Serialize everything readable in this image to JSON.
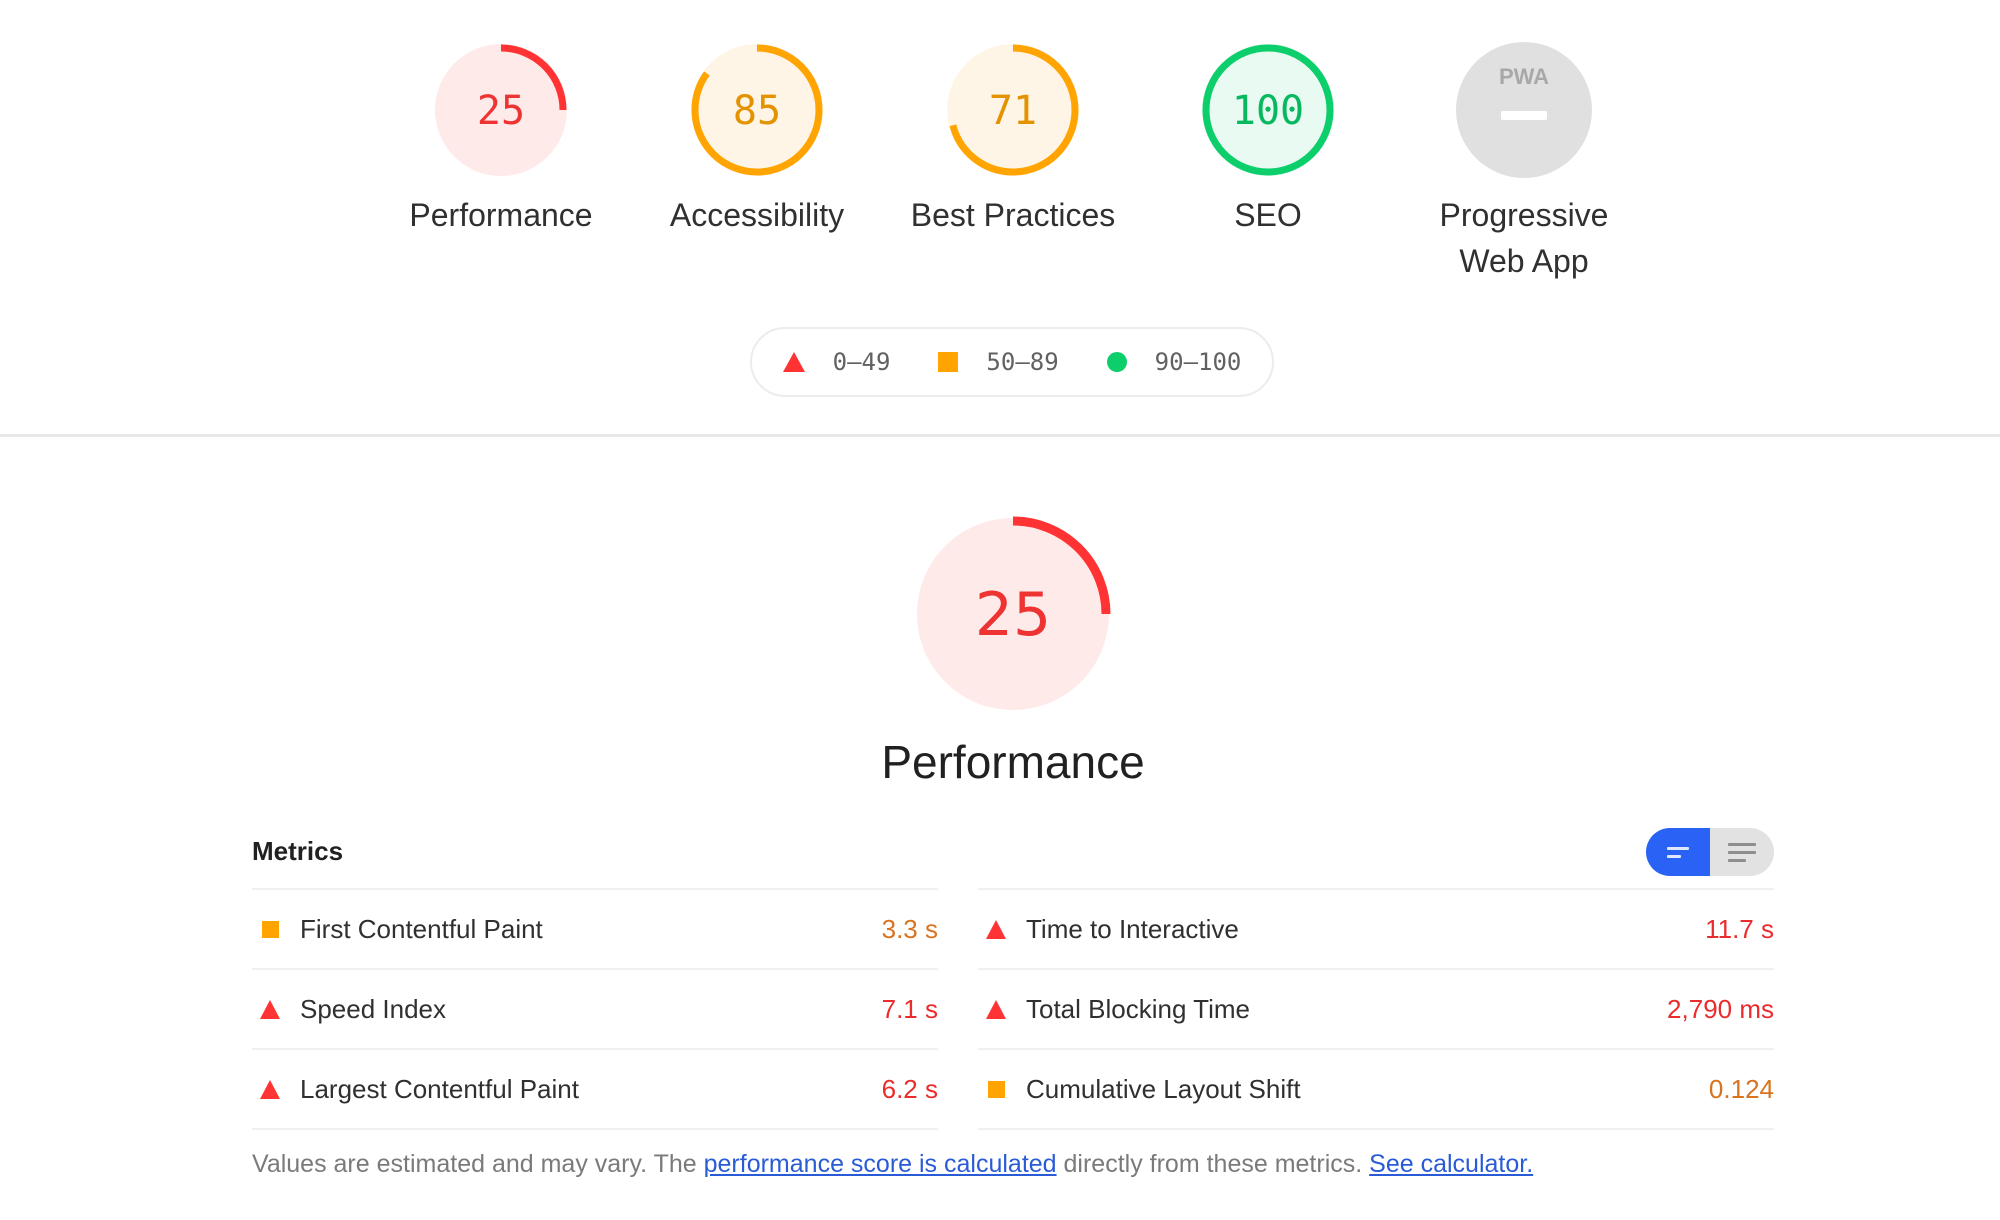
{
  "colors": {
    "fail": "#ff3333",
    "fail_bg": "#ffeaea",
    "fail_text": "#ee3333",
    "average": "#ffa400",
    "average_bg": "#fff5e6",
    "average_text": "#e39300",
    "pass": "#0cce6b",
    "pass_bg": "#e8faf1",
    "pass_text": "#08b85e",
    "na_bg": "#e0e0e0",
    "toggle_active": "#2a62f5",
    "link": "#2a5bd7"
  },
  "categories": [
    {
      "id": "performance",
      "label": "Performance",
      "score": 25,
      "rating": "fail"
    },
    {
      "id": "accessibility",
      "label": "Accessibility",
      "score": 85,
      "rating": "average"
    },
    {
      "id": "best-practices",
      "label": "Best Practices",
      "score": 71,
      "rating": "average"
    },
    {
      "id": "seo",
      "label": "SEO",
      "score": 100,
      "rating": "pass"
    },
    {
      "id": "pwa",
      "label_line1": "Progressive",
      "label_line2": "Web App",
      "badge": "PWA",
      "rating": "na"
    }
  ],
  "legend": {
    "fail": "0–49",
    "average": "50–89",
    "pass": "90–100"
  },
  "performance_section": {
    "score": 25,
    "title": "Performance"
  },
  "metrics": {
    "header": "Metrics",
    "left": [
      {
        "name": "First Contentful Paint",
        "value": "3.3 s",
        "rating": "average"
      },
      {
        "name": "Speed Index",
        "value": "7.1 s",
        "rating": "fail"
      },
      {
        "name": "Largest Contentful Paint",
        "value": "6.2 s",
        "rating": "fail"
      }
    ],
    "right": [
      {
        "name": "Time to Interactive",
        "value": "11.7 s",
        "rating": "fail"
      },
      {
        "name": "Total Blocking Time",
        "value": "2,790 ms",
        "rating": "fail"
      },
      {
        "name": "Cumulative Layout Shift",
        "value": "0.124",
        "rating": "average"
      }
    ]
  },
  "footnote": {
    "text1": "Values are estimated and may vary. The ",
    "link1": "performance score is calculated",
    "text2": " directly from these metrics. ",
    "link2": "See calculator."
  }
}
